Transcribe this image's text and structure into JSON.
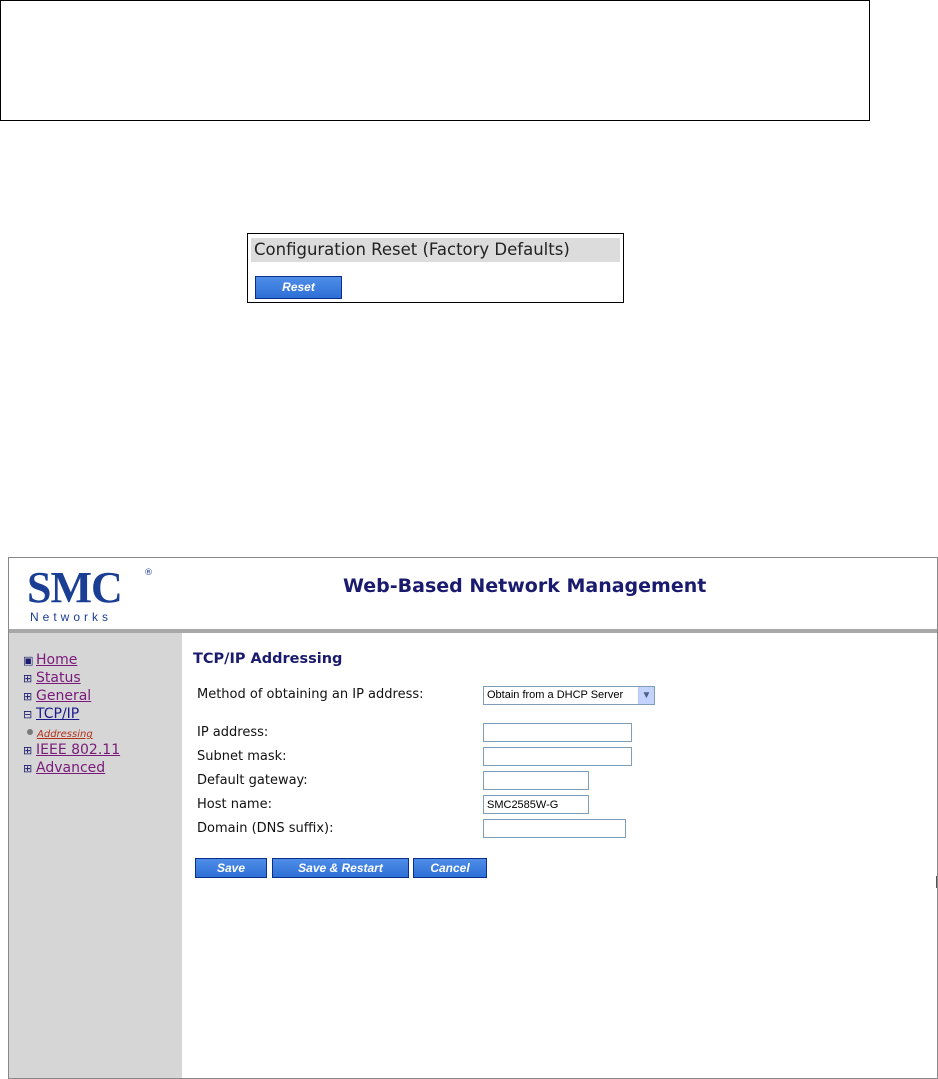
{
  "reset_panel": {
    "title": "Configuration Reset (Factory Defaults)",
    "button_label": "Reset"
  },
  "header": {
    "logo_text": "SMC",
    "logo_subtext": "Networks",
    "title": "Web-Based Network Management"
  },
  "sidebar": {
    "items": [
      {
        "icon": "dot-box-icon",
        "symbol": "▣",
        "label": "Home"
      },
      {
        "icon": "expand-plus-icon",
        "symbol": "⊞",
        "label": "Status"
      },
      {
        "icon": "expand-plus-icon",
        "symbol": "⊞",
        "label": "General"
      },
      {
        "icon": "collapse-minus-icon",
        "symbol": "⊟",
        "label": "TCP/IP"
      },
      {
        "icon": "expand-plus-icon",
        "symbol": "⊞",
        "label": "IEEE 802.11"
      },
      {
        "icon": "expand-plus-icon",
        "symbol": "⊞",
        "label": "Advanced"
      }
    ],
    "sub_item": "Addressing"
  },
  "main": {
    "title": "TCP/IP Addressing",
    "method_label": "Method of obtaining an IP address:",
    "method_value": "Obtain from a DHCP Server",
    "fields": [
      {
        "label": "IP address:",
        "value": ""
      },
      {
        "label": "Subnet mask:",
        "value": ""
      },
      {
        "label": "Default gateway:",
        "value": ""
      },
      {
        "label": "Host name:",
        "value": "SMC2585W-G"
      },
      {
        "label": "Domain (DNS suffix):",
        "value": ""
      }
    ],
    "buttons": {
      "save": "Save",
      "save_restart": "Save & Restart",
      "cancel": "Cancel"
    }
  },
  "colors": {
    "button_blue": "#2d6fd6",
    "header_navy": "#1a1a6e",
    "sidebar_gray": "#d6d6d6",
    "link_purple": "#7a1a7a"
  }
}
